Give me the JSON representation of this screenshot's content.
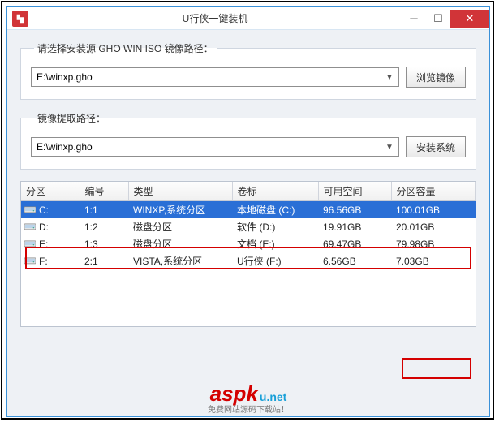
{
  "window": {
    "title": "U行侠一键装机"
  },
  "source_section": {
    "legend": "请选择安装源 GHO WIN ISO 镜像路径：",
    "combo_value": "E:\\winxp.gho",
    "browse_label": "浏览镜像"
  },
  "extract_section": {
    "legend": "镜像提取路径：",
    "combo_value": "E:\\winxp.gho",
    "install_label": "安装系统"
  },
  "table": {
    "headers": [
      "分区",
      "编号",
      "类型",
      "卷标",
      "可用空间",
      "分区容量"
    ],
    "rows": [
      {
        "drive": "C:",
        "num": "1:1",
        "type": "WINXP,系统分区",
        "label": "本地磁盘 (C:)",
        "free": "96.56GB",
        "total": "100.01GB",
        "selected": true
      },
      {
        "drive": "D:",
        "num": "1:2",
        "type": "磁盘分区",
        "label": "软件 (D:)",
        "free": "19.91GB",
        "total": "20.01GB",
        "selected": false
      },
      {
        "drive": "E:",
        "num": "1:3",
        "type": "磁盘分区",
        "label": "文档 (E:)",
        "free": "69.47GB",
        "total": "79.98GB",
        "selected": false
      },
      {
        "drive": "F:",
        "num": "2:1",
        "type": "VISTA,系统分区",
        "label": "U行侠 (F:)",
        "free": "6.56GB",
        "total": "7.03GB",
        "selected": false
      }
    ]
  },
  "watermark": {
    "a": "aspk",
    "b": "u.net",
    "c": "免费网站源码下载站！"
  }
}
